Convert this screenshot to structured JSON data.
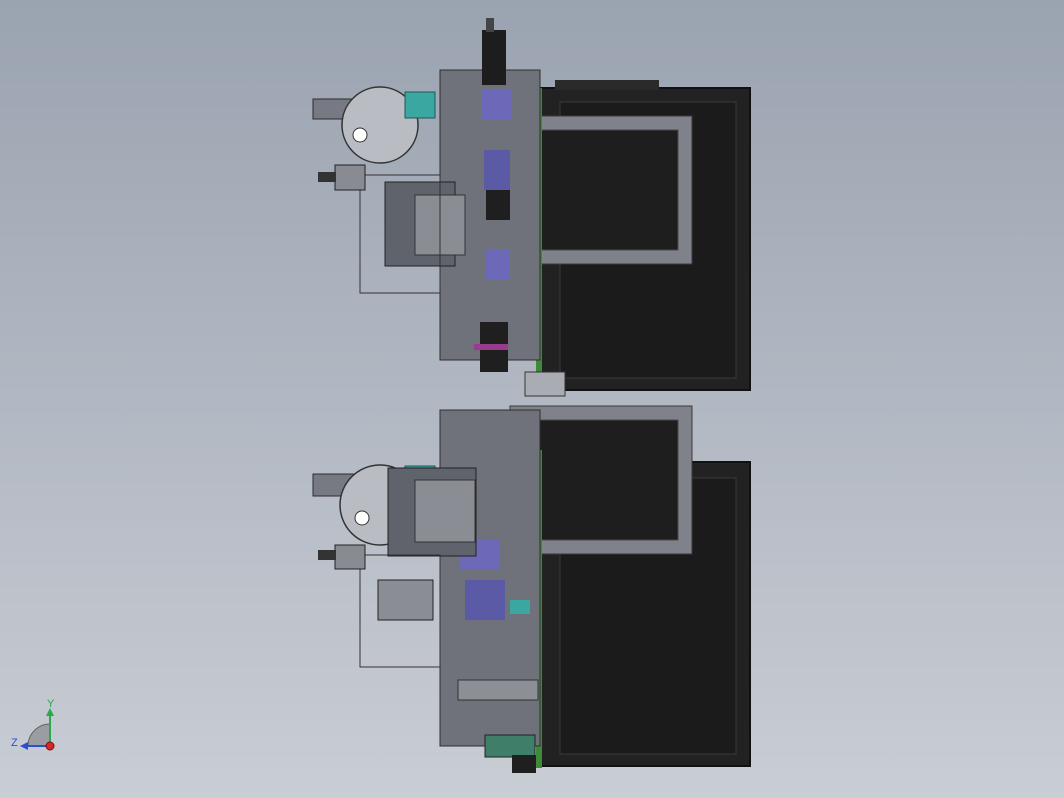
{
  "viewport": {
    "background_top": "#9aa3b0",
    "background_bottom": "#c9cdd4"
  },
  "model": {
    "description_icon": "cad-assembly-side-view",
    "colors": {
      "frame_dark": "#1f1f1f",
      "panel_outline": "#3a3a3a",
      "gray_part": "#7d8088",
      "light_gray_part": "#a9acb2",
      "blue_purple": "#6c6ab8",
      "teal": "#3aa7a0",
      "brown": "#7a4a2c",
      "green_board": "#3f8a3a",
      "magenta": "#9a3c8e"
    }
  },
  "triad": {
    "y_label": "Y",
    "z_label": "Z",
    "y_color": "#2aa84a",
    "z_color": "#2c4fd0",
    "x_color": "#d62828"
  }
}
